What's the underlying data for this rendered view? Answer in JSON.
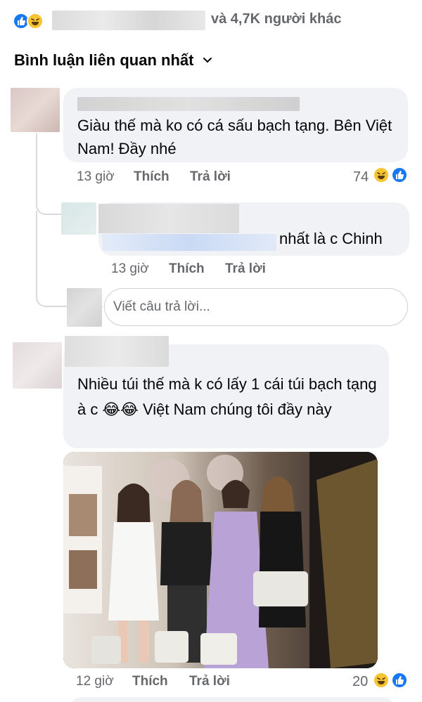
{
  "reactions_summary": {
    "text": "và 4,7K người khác",
    "icons": [
      "like-icon",
      "haha-icon"
    ]
  },
  "sort": {
    "label": "Bình luận liên quan nhất",
    "icon": "chevron-down-icon"
  },
  "comments": [
    {
      "text": "Giàu thế mà ko có cá sấu bạch tạng. Bên Việt Nam! Đầy nhé",
      "time": "13 giờ",
      "like_label": "Thích",
      "reply_label": "Trả lời",
      "reaction_count": "74"
    },
    {
      "text": "Nhiều túi thế mà k có lấy 1 cái túi bạch tạng à c 😂😂 Việt Nam chúng tôi đầy này",
      "time": "12 giờ",
      "like_label": "Thích",
      "reply_label": "Trả lời",
      "reaction_count": "20"
    }
  ],
  "reply": {
    "text": "nhất là c Chinh",
    "time": "13 giờ",
    "like_label": "Thích",
    "reply_label": "Trả lời"
  },
  "reply_input": {
    "placeholder": "Viết câu trả lời..."
  },
  "colors": {
    "bubble": "#f0f2f5",
    "meta_text": "#65676b",
    "like_blue": "#1877f2",
    "haha_yellow": "#f7c531"
  }
}
